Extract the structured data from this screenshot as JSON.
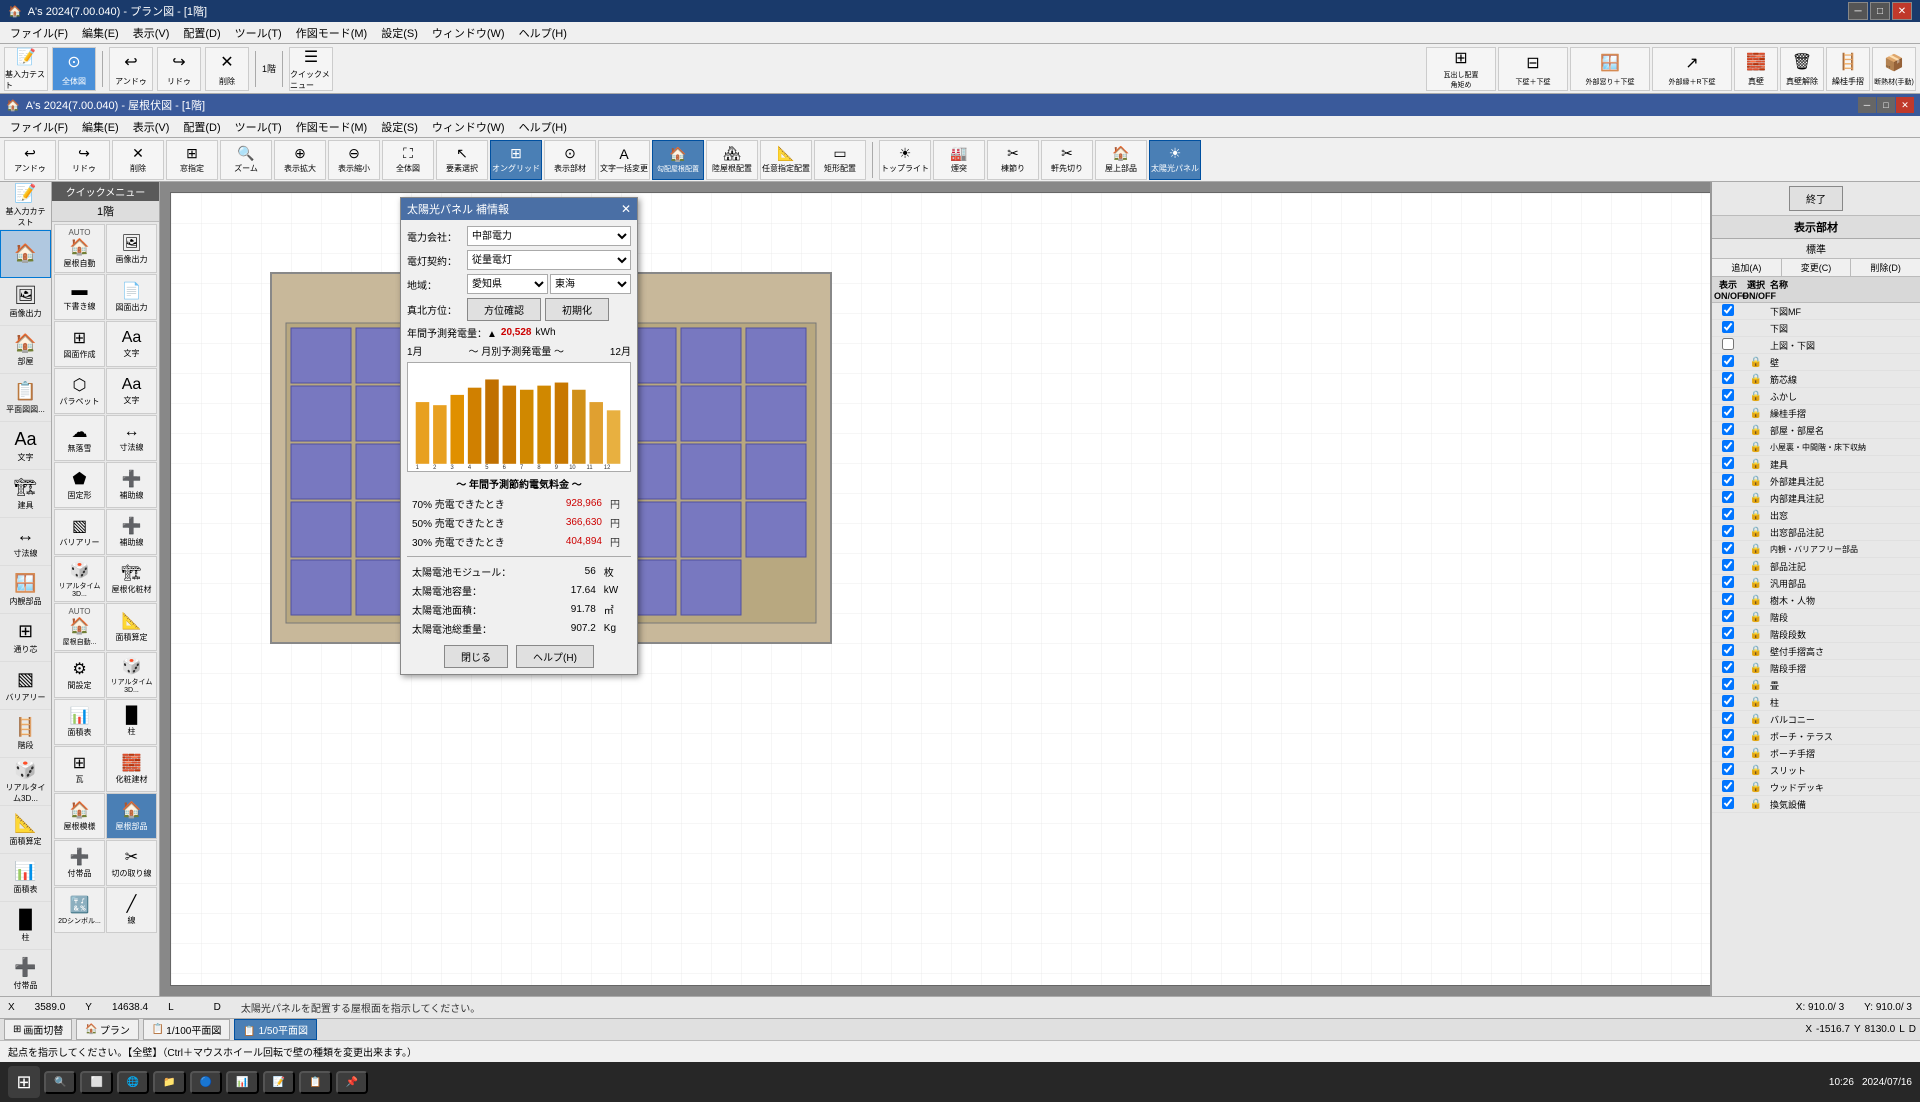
{
  "app": {
    "title": "A's 2024(7.00.040) - プラン図 - [1階]",
    "inner_title": "A's 2024(7.00.040) - 屋根伏図 - [1階]"
  },
  "outer_menu": {
    "items": [
      "ファイル(F)",
      "編集(E)",
      "表示(V)",
      "配置(D)",
      "ツール(T)",
      "作図モード(M)",
      "設定(S)",
      "ウィンドウ(W)",
      "ヘルプ(H)"
    ]
  },
  "inner_menu": {
    "items": [
      "ファイル(F)",
      "編集(E)",
      "表示(V)",
      "配置(D)",
      "ツール(T)",
      "作図モード(M)",
      "設定(S)",
      "ウィンドウ(W)",
      "ヘルプ(H)"
    ]
  },
  "main_toolbar": {
    "buttons": [
      {
        "id": "undo",
        "icon": "↩",
        "label": "アンドゥ"
      },
      {
        "id": "redo",
        "icon": "↪",
        "label": "リドゥ"
      },
      {
        "id": "delete",
        "icon": "✕",
        "label": "削除"
      },
      {
        "id": "window-spec",
        "icon": "⊞",
        "label": "窓指定"
      },
      {
        "id": "zoom",
        "icon": "🔍",
        "label": "ズーム"
      },
      {
        "id": "zoom-in",
        "icon": "⊕",
        "label": "表示拡大"
      },
      {
        "id": "zoom-out",
        "icon": "⊖",
        "label": "表示縮小"
      },
      {
        "id": "full",
        "icon": "⛶",
        "label": "全体図"
      },
      {
        "id": "select",
        "icon": "↖",
        "label": "要素選択"
      },
      {
        "id": "ongrid",
        "icon": "⊞",
        "label": "オングリッド"
      },
      {
        "id": "display",
        "icon": "⊙",
        "label": "表示部材"
      },
      {
        "id": "text-change",
        "icon": "A",
        "label": "文字一括変更"
      },
      {
        "id": "roof-auto",
        "icon": "🏠",
        "label": "勾配屋根配置"
      },
      {
        "id": "ridge-place",
        "icon": "🏘",
        "label": "陸屋根配置"
      },
      {
        "id": "any-place",
        "icon": "📐",
        "label": "任意指定配置"
      },
      {
        "id": "rect-place",
        "icon": "▭",
        "label": "矩形配置"
      }
    ]
  },
  "roof_toolbar": {
    "buttons": [
      {
        "id": "toplight",
        "icon": "☀",
        "label": "トップライト"
      },
      {
        "id": "chimney",
        "icon": "🏭",
        "label": "煙突"
      },
      {
        "id": "ridge-cut",
        "icon": "✂",
        "label": "棟節り"
      },
      {
        "id": "eave-cut",
        "icon": "✂",
        "label": "軒先切り"
      },
      {
        "id": "upper-part",
        "icon": "🏠",
        "label": "屋上部品"
      },
      {
        "id": "solar",
        "icon": "☀",
        "label": "太陽光パネル",
        "active": true
      }
    ]
  },
  "quick_menu": {
    "header": "クイックメニュー",
    "floor": "1階",
    "items": [
      {
        "id": "roof-auto",
        "icon": "🏠",
        "label": "屋根自動",
        "auto": true
      },
      {
        "id": "image-out",
        "icon": "🖼",
        "label": "画像出力"
      },
      {
        "id": "floor-plan",
        "icon": "📋",
        "label": "平面図図..."
      },
      {
        "id": "down-wall",
        "icon": "▬",
        "label": "下書き線"
      },
      {
        "id": "draw-out",
        "icon": "📄",
        "label": "図面出力"
      },
      {
        "id": "text",
        "icon": "A",
        "label": "文字"
      },
      {
        "id": "line",
        "icon": "╱",
        "label": "線"
      },
      {
        "id": "layout",
        "icon": "⊞",
        "label": "図面作成"
      },
      {
        "id": "pallet",
        "icon": "⬡",
        "label": "パラペット"
      },
      {
        "id": "text2",
        "icon": "A",
        "label": "文字"
      },
      {
        "id": "dim-line",
        "icon": "↔",
        "label": "寸法線"
      },
      {
        "id": "nocloud",
        "icon": "☁",
        "label": "無落雪"
      },
      {
        "id": "dim-line2",
        "icon": "↔",
        "label": "寸法線"
      },
      {
        "id": "fixed-shape",
        "icon": "⬟",
        "label": "固定形"
      },
      {
        "id": "support",
        "icon": "➕",
        "label": "補助線"
      },
      {
        "id": "interior",
        "icon": "🪟",
        "label": "内観部品"
      },
      {
        "id": "tsuji",
        "icon": "⊞",
        "label": "通り芯"
      },
      {
        "id": "valley-barrier",
        "icon": "▧",
        "label": "バリアリー"
      },
      {
        "id": "support2",
        "icon": "➕",
        "label": "補助線"
      },
      {
        "id": "stairs",
        "icon": "🪜",
        "label": "階段"
      },
      {
        "id": "realtime3d",
        "icon": "🎲",
        "label": "リアルタイム3D..."
      },
      {
        "id": "roof-exterior",
        "icon": "🏗",
        "label": "屋根化粧材"
      },
      {
        "id": "roof-auto2",
        "icon": "🏠",
        "label": "屋根自動...",
        "auto": true
      },
      {
        "id": "area-calc",
        "icon": "📐",
        "label": "面積算定"
      },
      {
        "id": "room-setup",
        "icon": "⚙",
        "label": "間設定"
      },
      {
        "id": "realtime3d2",
        "icon": "🎲",
        "label": "リアルタイム3D..."
      },
      {
        "id": "area-table",
        "icon": "📊",
        "label": "面積表"
      },
      {
        "id": "pillar",
        "icon": "█",
        "label": "柱"
      },
      {
        "id": "add-parts",
        "icon": "➕",
        "label": "付帯品品"
      },
      {
        "id": "tile",
        "icon": "⊞",
        "label": "瓦"
      },
      {
        "id": "chem-mat",
        "icon": "🧱",
        "label": "化粧建材"
      },
      {
        "id": "roof-model",
        "icon": "🏠",
        "label": "屋根模様"
      },
      {
        "id": "roof-parts",
        "icon": "🏠",
        "label": "屋根部品",
        "active": true
      },
      {
        "id": "cut-line",
        "icon": "✂",
        "label": "切の取り線"
      },
      {
        "id": "2d-symbol",
        "icon": "🔣",
        "label": "2Dシンボル..."
      },
      {
        "id": "line2",
        "icon": "╱",
        "label": "線"
      }
    ]
  },
  "dialog": {
    "title": "太陽光パネル 補情報",
    "fields": {
      "power_company_label": "電力会社：",
      "power_company_value": "中部電力",
      "contract_label": "電灯契約：",
      "contract_value": "従量電灯",
      "region_label": "地域：",
      "region_value": "愛知県",
      "sub_region_value": "東海",
      "orientation_label": "真北方位：",
      "orientation_btn": "方位確認",
      "reset_btn": "初期化"
    },
    "generation": {
      "label": "年間予測発電量：▲",
      "value": "20,528",
      "unit": "kWh",
      "month_start": "1月",
      "month_label": "～ 月別予測発電量 ～",
      "month_end": "12月"
    },
    "savings_title": "～ 年間予測節約電気料金 ～",
    "savings": [
      {
        "label": "70% 売電できたとき",
        "value": "928,966",
        "unit": "円"
      },
      {
        "label": "50% 売電できたとき",
        "value": "366,630",
        "unit": "円"
      },
      {
        "label": "30% 売電できたとき",
        "value": "404,894",
        "unit": "円"
      }
    ],
    "specs": [
      {
        "label": "太陽電池モジュール：",
        "value": "56",
        "unit": "枚"
      },
      {
        "label": "太陽電池容量：",
        "value": "17.64",
        "unit": "kW"
      },
      {
        "label": "太陽電池面積：",
        "value": "91.78",
        "unit": "㎡"
      },
      {
        "label": "太陽電池総重量：",
        "value": "907.2",
        "unit": "Kg"
      }
    ],
    "close_btn": "閉じる",
    "help_btn": "ヘルプ(H)"
  },
  "chart": {
    "months": [
      "1",
      "2",
      "3",
      "4",
      "5",
      "6",
      "7",
      "8",
      "9",
      "10",
      "11",
      "12"
    ],
    "heights": [
      65,
      62,
      72,
      80,
      88,
      82,
      78,
      82,
      85,
      78,
      65,
      58
    ]
  },
  "display_panel": {
    "title": "表示部材",
    "sub": "標準",
    "add_btn": "追加(A)",
    "change_btn": "変更(C)",
    "delete_btn": "削除(D)",
    "headers": [
      "表示\nON/OFF",
      "選択\nON/OFF",
      "名称"
    ],
    "items": [
      {
        "checked": true,
        "locked": false,
        "label": "下図MF"
      },
      {
        "checked": true,
        "locked": false,
        "label": "下図"
      },
      {
        "checked": false,
        "locked": false,
        "label": "上図・下図"
      },
      {
        "checked": true,
        "locked": true,
        "label": "壁"
      },
      {
        "checked": true,
        "locked": true,
        "label": "筋芯線"
      },
      {
        "checked": true,
        "locked": true,
        "label": "ふかし"
      },
      {
        "checked": true,
        "locked": true,
        "label": "繰桂手摺"
      },
      {
        "checked": true,
        "locked": true,
        "label": "部屋・部屋名"
      },
      {
        "checked": true,
        "locked": true,
        "label": "小屋裏・中間階・床下収納"
      },
      {
        "checked": true,
        "locked": true,
        "label": "建具"
      },
      {
        "checked": true,
        "locked": true,
        "label": "外部建具注記"
      },
      {
        "checked": true,
        "locked": true,
        "label": "内部建具注記"
      },
      {
        "checked": true,
        "locked": true,
        "label": "出窓"
      },
      {
        "checked": true,
        "locked": true,
        "label": "出窓部品注記"
      },
      {
        "checked": true,
        "locked": true,
        "label": "内観・バリアフリー部品"
      },
      {
        "checked": true,
        "locked": true,
        "label": "部品注記"
      },
      {
        "checked": true,
        "locked": true,
        "label": "汎用部品"
      },
      {
        "checked": true,
        "locked": true,
        "label": "樹木・人物"
      },
      {
        "checked": true,
        "locked": true,
        "label": "階段"
      },
      {
        "checked": true,
        "locked": true,
        "label": "階段段数"
      },
      {
        "checked": true,
        "locked": true,
        "label": "壁付手摺高さ"
      },
      {
        "checked": true,
        "locked": true,
        "label": "階段手摺"
      },
      {
        "checked": true,
        "locked": true,
        "label": "畳"
      },
      {
        "checked": true,
        "locked": true,
        "label": "柱"
      },
      {
        "checked": true,
        "locked": true,
        "label": "バルコニー"
      },
      {
        "checked": true,
        "locked": true,
        "label": "ポーチ・テラス"
      },
      {
        "checked": true,
        "locked": true,
        "label": "ポーチ手摺"
      },
      {
        "checked": true,
        "locked": true,
        "label": "スリット"
      },
      {
        "checked": true,
        "locked": true,
        "label": "ウッドデッキ"
      },
      {
        "checked": true,
        "locked": true,
        "label": "換気設備"
      }
    ]
  },
  "status_bar": {
    "x_label": "X",
    "x_value": "3589.0",
    "y_label": "Y",
    "y_value": "14638.4",
    "l_label": "L",
    "d_label": "D",
    "message": "太陽光パネルを配置する屋根面を指示してください。",
    "cursor_x": "X: 910.0/ 3",
    "cursor_y": "Y: 910.0/ 3"
  },
  "bottom_toolbar": {
    "tabs": [
      {
        "id": "screen-cut",
        "label": "画面切替",
        "icon": "⊞",
        "active": false
      },
      {
        "id": "plan",
        "label": "プラン",
        "icon": "",
        "active": false
      },
      {
        "id": "plan-100",
        "label": "1/100平面図",
        "icon": "",
        "active": false
      },
      {
        "id": "plan-50",
        "label": "1/50平面図",
        "icon": "",
        "active": true
      }
    ],
    "x_label": "X",
    "x_value": "-1516.7",
    "y_label": "Y",
    "y_value": "8130.0",
    "l_label": "L",
    "d_label": "D"
  },
  "bottom_status": {
    "message": "起点を指示してください。【全壁】（Ctrl＋マウスホイール回転で壁の種類を変更出来ます。）"
  },
  "taskbar": {
    "time": "10:26",
    "date": "2024/07/16"
  },
  "right_toolbar": {
    "buttons": [
      {
        "id": "protrude",
        "icon": "⊞",
        "label": "瓦出し配置\n角矩め"
      },
      {
        "id": "outer-wall-bottom",
        "icon": "⊞",
        "label": "下壁＋下壁"
      },
      {
        "id": "outer-window-bottom",
        "icon": "⊞",
        "label": "外部窓り＋下壁"
      },
      {
        "id": "outer-wall-r",
        "icon": "⊞",
        "label": "外部縁＋R下壁"
      },
      {
        "id": "true-wall",
        "icon": "⊞",
        "label": "真壁"
      },
      {
        "id": "true-wall-del",
        "icon": "⊞",
        "label": "真壁解除"
      },
      {
        "id": "true-wall-hand",
        "icon": "⊞",
        "label": "繰桂手摺"
      },
      {
        "id": "insulation",
        "icon": "⊞",
        "label": "断熱材(手動)"
      },
      {
        "id": "finish",
        "icon": "⊙",
        "label": "終了"
      }
    ]
  }
}
